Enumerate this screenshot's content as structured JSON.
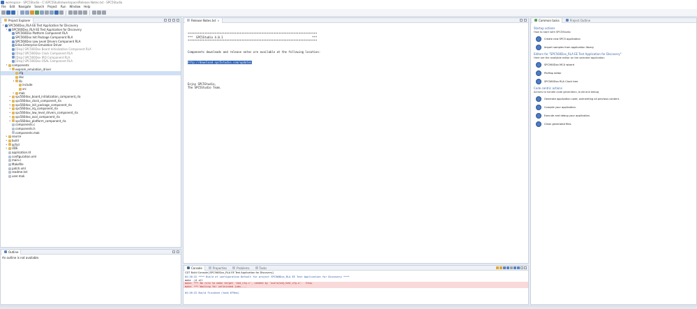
{
  "window": {
    "title": "workspace - SPC5Studio - C:\\SPC5Studio\\workspace\\Release Notes.txt - SPC5Studio"
  },
  "menu": [
    "File",
    "Edit",
    "Navigate",
    "Search",
    "Project",
    "Run",
    "Window",
    "Help"
  ],
  "project_explorer": {
    "tab_label": "Project Explorer",
    "tree": [
      {
        "indent": 0,
        "arrow": "▾",
        "icon": "proj",
        "label": "SPC560Dxx_RLA EE Test Application for Discovery",
        "dim": false
      },
      {
        "indent": 1,
        "arrow": "▾",
        "icon": "proj",
        "label": "SPC560Dxx_RLA EE Test Application for Discovery",
        "dim": false
      },
      {
        "indent": 2,
        "arrow": "",
        "icon": "comp",
        "label": "SPC560Dxx Platform Component RLA",
        "dim": false
      },
      {
        "indent": 2,
        "arrow": "",
        "icon": "comp",
        "label": "SPC560Dxx Init Package Component RLA",
        "dim": false
      },
      {
        "indent": 2,
        "arrow": "",
        "icon": "comp",
        "label": "SPC560Dxx Low Level Drivers Component RLA",
        "dim": false
      },
      {
        "indent": 2,
        "arrow": "",
        "icon": "comp",
        "label": "Erika Enterprise Emulation Driver",
        "dim": false
      },
      {
        "indent": 2,
        "arrow": "",
        "icon": "comp",
        "label": "[Disp] SPC560Dxx Board Initialization Component RLA",
        "dim": true
      },
      {
        "indent": 2,
        "arrow": "",
        "icon": "comp",
        "label": "[Disp] SPC560Dxx Clock Component RLA",
        "dim": true
      },
      {
        "indent": 2,
        "arrow": "",
        "icon": "comp",
        "label": "[Disp] SPC560Dxx IRQ Component RLA",
        "dim": true
      },
      {
        "indent": 2,
        "arrow": "",
        "icon": "comp",
        "label": "[Disp] SPC560Dxx OSAL Component RLA",
        "dim": true
      },
      {
        "indent": 1,
        "arrow": "▾",
        "icon": "folder",
        "label": "components",
        "dim": false
      },
      {
        "indent": 2,
        "arrow": "▾",
        "icon": "folder",
        "label": "eeprom_emulation_driver",
        "dim": false
      },
      {
        "indent": 3,
        "arrow": "",
        "icon": "folder",
        "label": "cfg",
        "dim": false,
        "selected": true
      },
      {
        "indent": 3,
        "arrow": "",
        "icon": "folder",
        "label": "doc",
        "dim": false
      },
      {
        "indent": 3,
        "arrow": "▾",
        "icon": "folder",
        "label": "lib",
        "dim": false
      },
      {
        "indent": 4,
        "arrow": "",
        "icon": "folder",
        "label": "include",
        "dim": false
      },
      {
        "indent": 4,
        "arrow": "",
        "icon": "folder",
        "label": "src",
        "dim": false
      },
      {
        "indent": 3,
        "arrow": "▸",
        "icon": "folder",
        "label": "mak",
        "dim": false
      },
      {
        "indent": 2,
        "arrow": "▸",
        "icon": "folder",
        "label": "spc560dxx_board_initialization_component_rla",
        "dim": false
      },
      {
        "indent": 2,
        "arrow": "▸",
        "icon": "folder",
        "label": "spc560dxx_clock_component_rla",
        "dim": false
      },
      {
        "indent": 2,
        "arrow": "▸",
        "icon": "folder",
        "label": "spc560dxx_init_package_component_rla",
        "dim": false
      },
      {
        "indent": 2,
        "arrow": "▸",
        "icon": "folder",
        "label": "spc560dxx_irq_component_rla",
        "dim": false
      },
      {
        "indent": 2,
        "arrow": "▸",
        "icon": "folder",
        "label": "spc560dxx_low_level_drivers_component_rla",
        "dim": false
      },
      {
        "indent": 2,
        "arrow": "▸",
        "icon": "folder",
        "label": "spc560dxx_osal_component_rla",
        "dim": false
      },
      {
        "indent": 2,
        "arrow": "▸",
        "icon": "folder",
        "label": "spc560dxx_platform_component_rla",
        "dim": false
      },
      {
        "indent": 2,
        "arrow": "",
        "icon": "file",
        "label": "components.c",
        "dim": false
      },
      {
        "indent": 2,
        "arrow": "",
        "icon": "file",
        "label": "components.h",
        "dim": false
      },
      {
        "indent": 2,
        "arrow": "",
        "icon": "file",
        "label": "components.mak",
        "dim": false
      },
      {
        "indent": 1,
        "arrow": "▸",
        "icon": "folder",
        "label": "source",
        "dim": false
      },
      {
        "indent": 1,
        "arrow": "▸",
        "icon": "folder",
        "label": "build",
        "dim": false
      },
      {
        "indent": 1,
        "arrow": "▸",
        "icon": "folder",
        "label": "qcfsd",
        "dim": false
      },
      {
        "indent": 1,
        "arrow": "▸",
        "icon": "folder",
        "label": "UDE",
        "dim": false
      },
      {
        "indent": 1,
        "arrow": "",
        "icon": "file",
        "label": "application.ld",
        "dim": false
      },
      {
        "indent": 1,
        "arrow": "",
        "icon": "file",
        "label": "configuration.xml",
        "dim": false
      },
      {
        "indent": 1,
        "arrow": "",
        "icon": "file",
        "label": "main.c",
        "dim": false
      },
      {
        "indent": 1,
        "arrow": "",
        "icon": "file",
        "label": "Makefile",
        "dim": false
      },
      {
        "indent": 1,
        "arrow": "",
        "icon": "file",
        "label": "patch.xml",
        "dim": false
      },
      {
        "indent": 1,
        "arrow": "",
        "icon": "file",
        "label": "readme.txt",
        "dim": false
      },
      {
        "indent": 1,
        "arrow": "",
        "icon": "file",
        "label": "user.mak",
        "dim": false
      }
    ]
  },
  "outline": {
    "tab_label": "Outline",
    "message": "An outline is not available."
  },
  "editor": {
    "tab_label": "Release Notes.txt",
    "lines": [
      "*****************************************************************************",
      "***  SPC5Studio 4.0.1                                                     ***",
      "*****************************************************************************",
      "",
      "",
      "Components downloads and release notes are available at the following location:"
    ],
    "link": "http://download.spc5studio.com/updates",
    "lines_after": [
      "",
      "",
      "",
      "Enjoy SPC5Studio,",
      "The SPC5Studio Team."
    ]
  },
  "console": {
    "tabs": [
      "Console",
      "Properties",
      "Problems",
      "Tasks"
    ],
    "header": "CDT Build Console [SPC560Dxx_RLA EE Test Application for Discovery]",
    "lines": [
      {
        "text": "04:26:22 **** Build of configuration Default for project SPC560Dxx_RLA EE Test Application for Discovery ****",
        "kind": "blue"
      },
      {
        "text": "make -j4 all",
        "kind": "normal"
      },
      {
        "text": "make: *** No rule to make target `eed_cfg.c', needed by `build/obj/eed_cfg.o'.  Stop.",
        "kind": "err"
      },
      {
        "text": "make: *** Waiting for unfinished jobs....",
        "kind": "err"
      },
      {
        "text": "",
        "kind": "normal"
      },
      {
        "text": "04:26:22 Build Finished (took 879ms)",
        "kind": "blue"
      }
    ]
  },
  "common_tasks": {
    "tab_label": "Common tasks",
    "tab2_label": "Project Outline",
    "sections": [
      {
        "title": "Startup actions",
        "desc": "How to start with SPC5Studio",
        "items": [
          "Create new SPC5 application",
          "Import samples from application library"
        ]
      },
      {
        "title": "Editors for \"SPC560Dxx_RLA EE Test Application for Discovery\"",
        "desc": "Here are the available editor on the selected application",
        "items": [
          "SPC560Dxx MCU wizard",
          "PinMap editor",
          "SPC560Dxx RLA Clock tree"
        ]
      },
      {
        "title": "Code centric actions",
        "desc": "Actions to handle code generation, build and debug",
        "items": [
          "Generate application code, overwriting all previous content.",
          "Compile your application.",
          "Execute and debug your application.",
          "Clean generated files."
        ]
      }
    ]
  }
}
